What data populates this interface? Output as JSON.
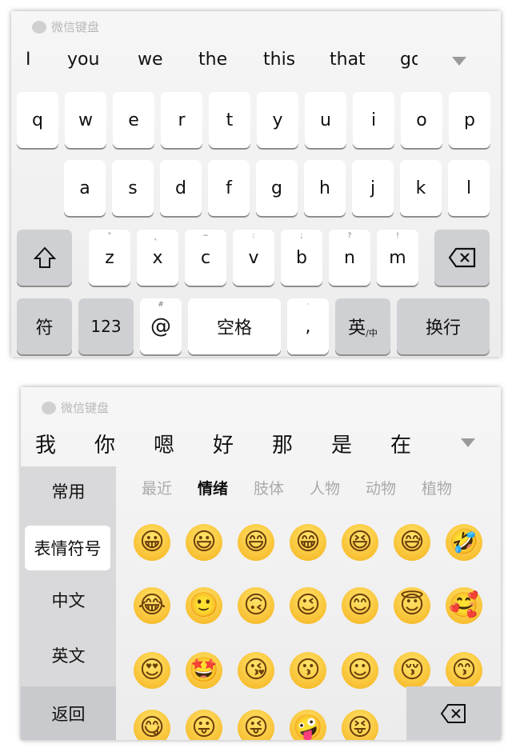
{
  "english_keyboard": {
    "brand": "微信键盘",
    "candidates": [
      "I",
      "you",
      "we",
      "the",
      "this",
      "that",
      "go"
    ],
    "row1": [
      "q",
      "w",
      "e",
      "r",
      "t",
      "y",
      "u",
      "i",
      "o",
      "p"
    ],
    "row2": [
      "a",
      "s",
      "d",
      "f",
      "g",
      "h",
      "j",
      "k",
      "l"
    ],
    "row3": [
      {
        "k": "z",
        "h": "\""
      },
      {
        "k": "x",
        "h": "、"
      },
      {
        "k": "c",
        "h": "~"
      },
      {
        "k": "v",
        "h": ":"
      },
      {
        "k": "b",
        "h": ";"
      },
      {
        "k": "n",
        "h": "?"
      },
      {
        "k": "m",
        "h": "!"
      }
    ],
    "symbols": "符",
    "numbers": "123",
    "at": "@",
    "at_hint": "#",
    "space": "空格",
    "comma": ",",
    "comma_hint": "·",
    "lang": "英",
    "lang_sub": "/中",
    "enter": "换行"
  },
  "emoji_keyboard": {
    "brand": "微信键盘",
    "candidates": [
      "我",
      "你",
      "嗯",
      "好",
      "那",
      "是",
      "在"
    ],
    "sidebar": [
      "常用",
      "表情符号",
      "中文",
      "英文",
      "返回"
    ],
    "selected_sidebar": "表情符号",
    "tabs": [
      "最近",
      "情绪",
      "肢体",
      "人物",
      "动物",
      "植物"
    ],
    "active_tab": "情绪",
    "emojis": [
      [
        "😀",
        "😃",
        "😄",
        "😁",
        "😆",
        "😅",
        "🤣"
      ],
      [
        "😂",
        "🙂",
        "🙃",
        "😉",
        "😊",
        "😇",
        "🥰"
      ],
      [
        "😍",
        "🤩",
        "😘",
        "😗",
        "☺",
        "😚",
        "😙"
      ],
      [
        "😋",
        "😛",
        "😜",
        "🤪",
        "😝"
      ]
    ]
  }
}
